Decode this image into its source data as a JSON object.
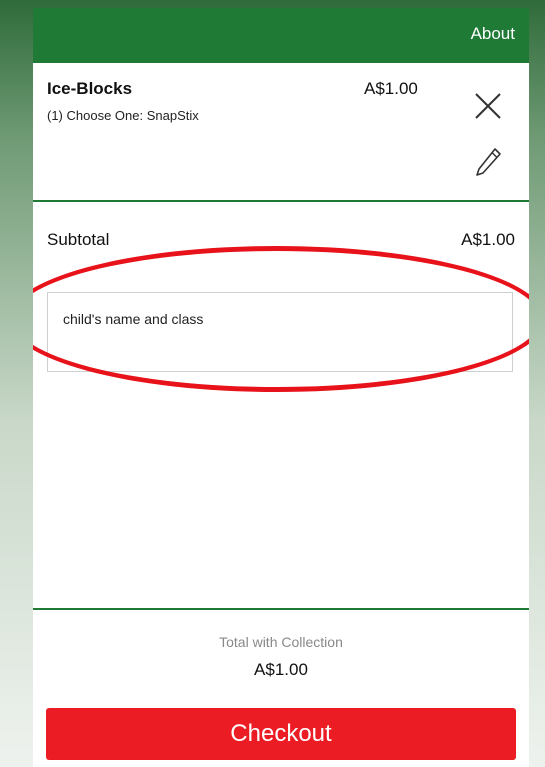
{
  "header": {
    "about_label": "About",
    "bg_color": "#1e7a35"
  },
  "cart": {
    "item": {
      "name": "Ice-Blocks",
      "option": "(1) Choose One: SnapStix",
      "price": "A$1.00",
      "remove_icon": "close-icon",
      "edit_icon": "pencil-icon"
    },
    "subtotal_label": "Subtotal",
    "subtotal_value": "A$1.00",
    "notes_value": "child's name and class",
    "annotation_color": "#e8121a"
  },
  "footer": {
    "total_label": "Total with Collection",
    "total_value": "A$1.00",
    "checkout_label": "Checkout",
    "checkout_color": "#ec1c24"
  }
}
